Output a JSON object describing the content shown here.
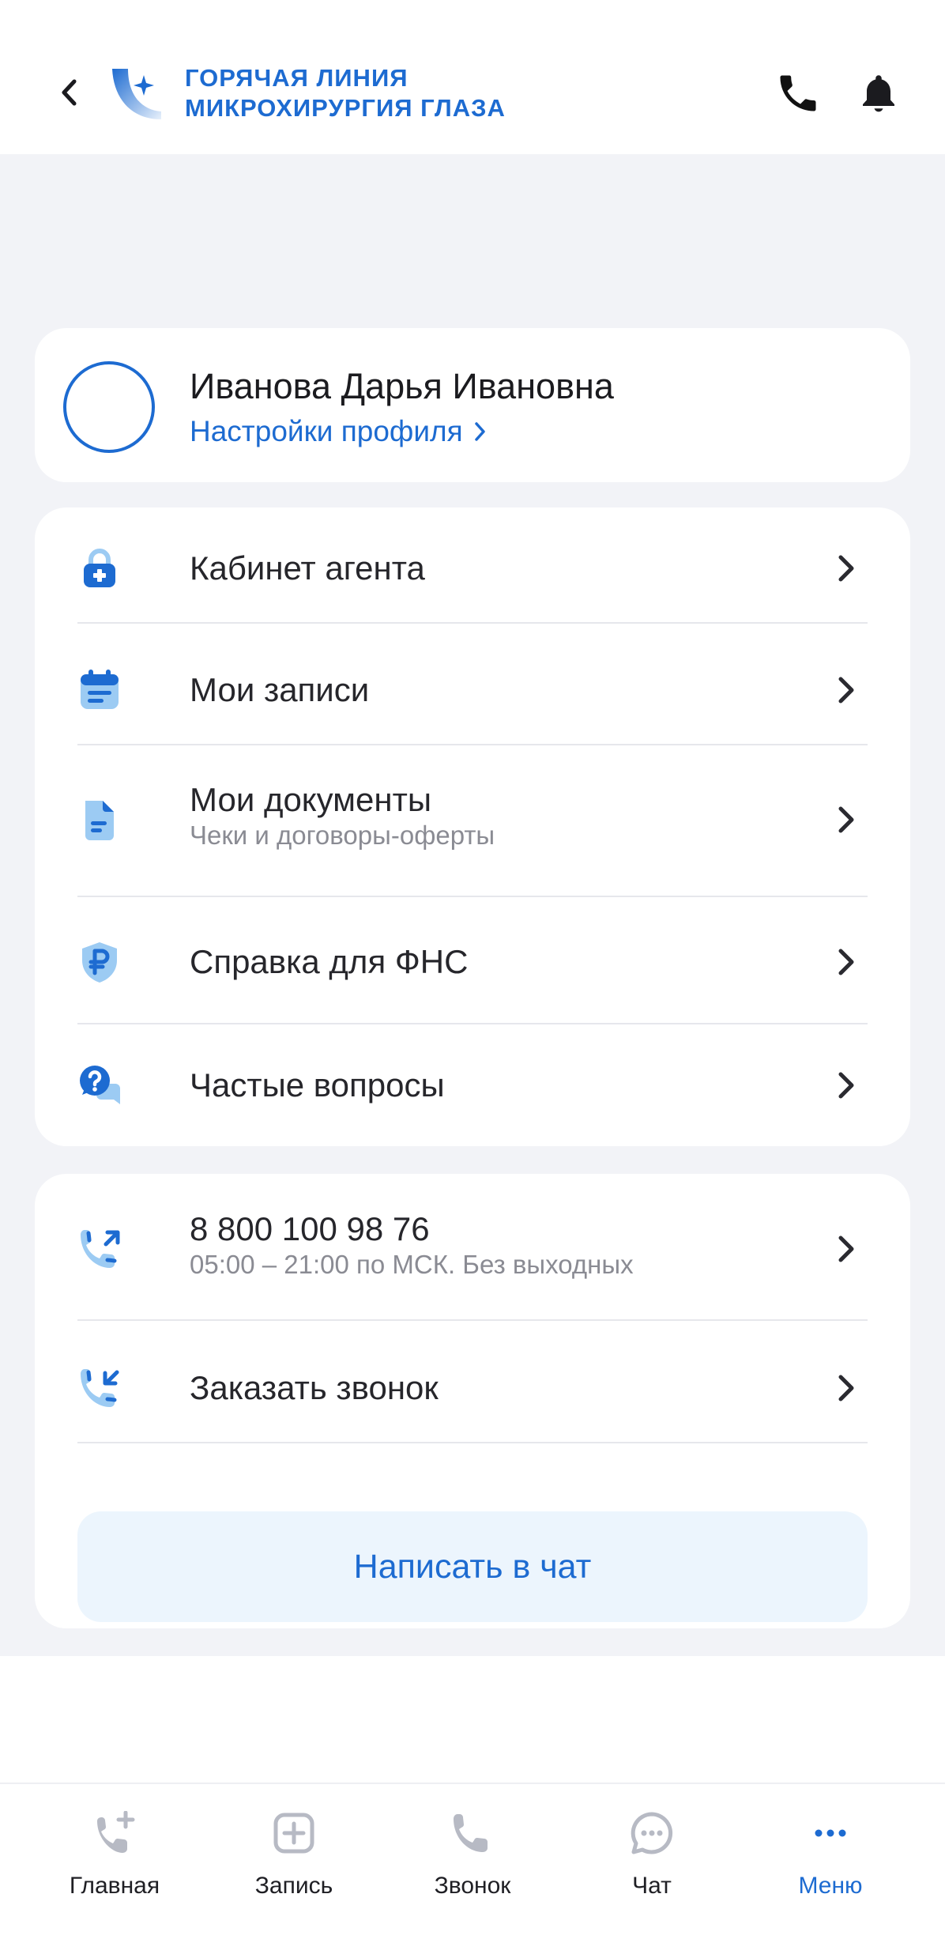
{
  "header": {
    "logo_line1": "ГОРЯЧАЯ ЛИНИЯ",
    "logo_line2": "МИКРОХИРУРГИЯ ГЛАЗА",
    "back_icon": "chevron-left-icon",
    "phone_icon": "phone-icon",
    "bell_icon": "bell-icon"
  },
  "profile": {
    "name": "Иванова Дарья Ивановна",
    "settings_link": "Настройки профиля"
  },
  "menu": {
    "items": [
      {
        "title": "Кабинет агента",
        "subtitle": "",
        "icon": "medical-lock-icon"
      },
      {
        "title": "Мои записи",
        "subtitle": "",
        "icon": "calendar-icon"
      },
      {
        "title": "Мои документы",
        "subtitle": "Чеки и договоры-оферты",
        "icon": "document-icon"
      },
      {
        "title": "Справка для ФНС",
        "subtitle": "",
        "icon": "ruble-shield-icon"
      },
      {
        "title": "Частые вопросы",
        "subtitle": "",
        "icon": "question-chat-icon"
      }
    ]
  },
  "contacts": {
    "phone": "8 800 100 98 76",
    "hours": "05:00 – 21:00 по МСК. Без выходных",
    "callback": "Заказать звонок",
    "chat_button": "Написать в чат"
  },
  "tabs": [
    {
      "label": "Главная",
      "icon": "phone-plus-icon",
      "active": false
    },
    {
      "label": "Запись",
      "icon": "plus-square-icon",
      "active": false
    },
    {
      "label": "Звонок",
      "icon": "phone-icon",
      "active": false
    },
    {
      "label": "Чат",
      "icon": "chat-bubble-icon",
      "active": false
    },
    {
      "label": "Меню",
      "icon": "more-dots-icon",
      "active": true
    }
  ],
  "colors": {
    "accent": "#1d6bd1",
    "background": "#f2f3f7",
    "card": "#ffffff",
    "chat_button_bg": "#ecf5fd",
    "muted_text": "#8a8b93",
    "tab_icon_inactive": "#b7bac4"
  }
}
